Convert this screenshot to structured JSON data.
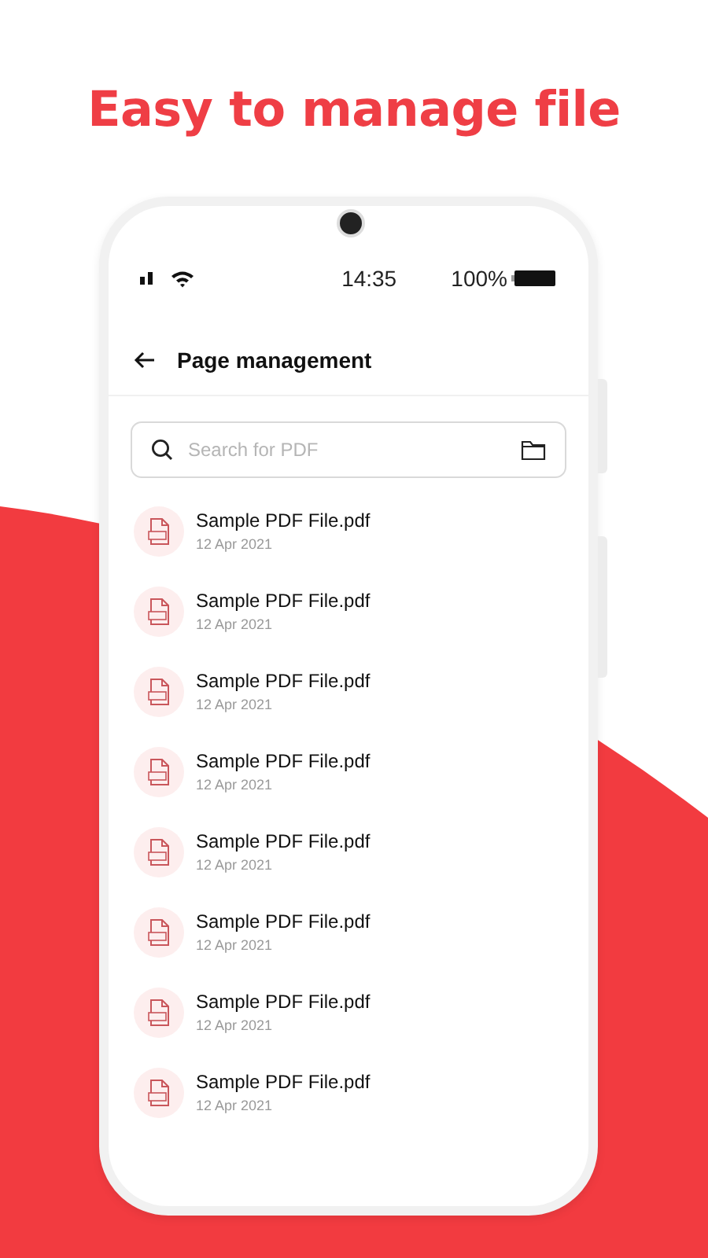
{
  "headline": "Easy to manage file",
  "status_bar": {
    "time": "14:35",
    "battery": "100%"
  },
  "header": {
    "title": "Page management"
  },
  "search": {
    "placeholder": "Search for PDF"
  },
  "files": [
    {
      "name": "Sample PDF File.pdf",
      "date": "12 Apr 2021"
    },
    {
      "name": "Sample PDF File.pdf",
      "date": "12 Apr 2021"
    },
    {
      "name": "Sample PDF File.pdf",
      "date": "12 Apr 2021"
    },
    {
      "name": "Sample PDF File.pdf",
      "date": "12 Apr 2021"
    },
    {
      "name": "Sample PDF File.pdf",
      "date": "12 Apr 2021"
    },
    {
      "name": "Sample PDF File.pdf",
      "date": "12 Apr 2021"
    },
    {
      "name": "Sample PDF File.pdf",
      "date": "12 Apr 2021"
    },
    {
      "name": "Sample PDF File.pdf",
      "date": "12 Apr 2021"
    }
  ]
}
